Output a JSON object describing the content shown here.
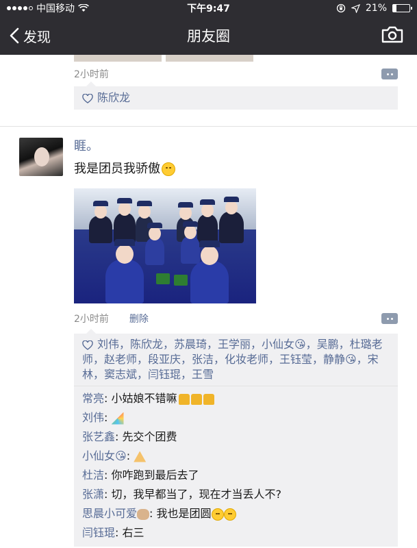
{
  "status_bar": {
    "carrier": "中国移动",
    "time": "下午9:47",
    "battery": "21%",
    "battery_level": 0.21
  },
  "nav": {
    "back_label": "发现",
    "title": "朋友圈"
  },
  "previous_post": {
    "time": "2小时前",
    "likes": [
      "陈欣龙"
    ]
  },
  "post": {
    "author": "睚。",
    "text": "我是团员我骄傲",
    "text_emoji": "smile-emoji",
    "time": "2小时前",
    "delete_label": "删除",
    "likes_text": "刘伟，陈欣龙，苏晨琦，王学丽，小仙女😘，吴鹏，杜璐老师，赵老师，段亚庆，张洁，化妆老师，王钰莹，静静😘，宋林，窦志斌，闫钰琨，王雪",
    "comments": [
      {
        "name": "常亮",
        "text": "小姑娘不错嘛",
        "emoji": "thumbs-up-emoji x3"
      },
      {
        "name": "刘伟",
        "text": "",
        "emoji": "party-popper-emoji"
      },
      {
        "name": "张艺鑫",
        "text": "先交个团费",
        "emoji": ""
      },
      {
        "name": "小仙女😘",
        "text": "",
        "emoji": "pray-emoji"
      },
      {
        "name": "杜洁",
        "text": "你咋跑到最后去了",
        "emoji": ""
      },
      {
        "name": "张潇",
        "text": "切，我早都当了，现在才当丢人不?",
        "emoji": ""
      },
      {
        "name": "思晨小可爱",
        "text": "我也是团圆",
        "emoji": "blush-emoji x2",
        "name_emoji": "puppy-emoji"
      },
      {
        "name": "闫钰琨",
        "text": "右三",
        "emoji": ""
      }
    ]
  }
}
